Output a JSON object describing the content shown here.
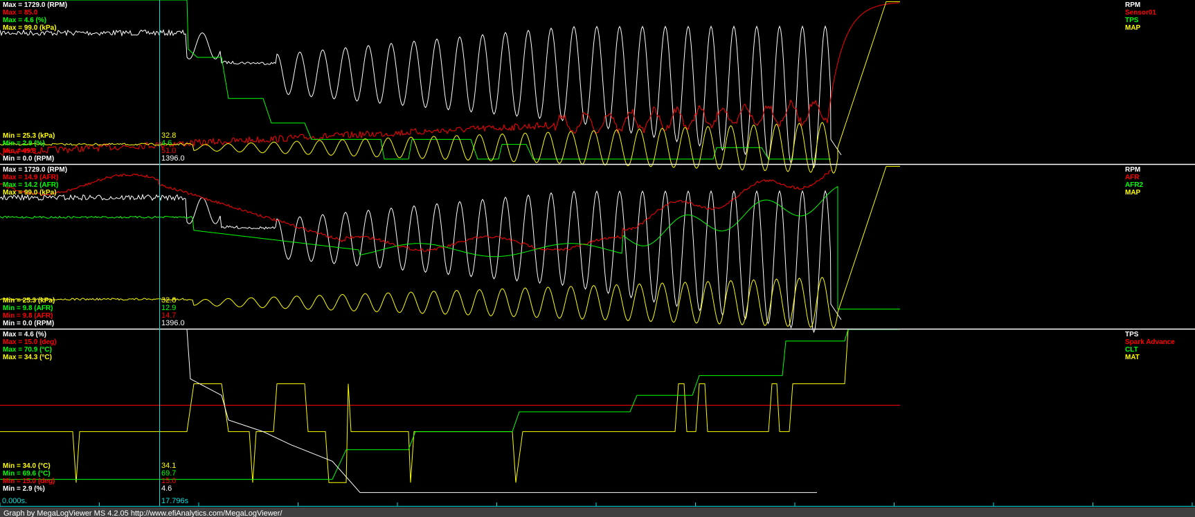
{
  "colors": {
    "background": "#000000",
    "white": "#ffffff",
    "red": "#ff0000",
    "green": "#00ff00",
    "yellow": "#ffff00",
    "cursor": "#00e0e0",
    "divider": "#ffffff",
    "footer_bg": "#404040"
  },
  "footer": {
    "credit": "Graph by MegaLogViewer MS 4.2.05 http://www.efiAnalytics.com/MegaLogViewer/"
  },
  "time_axis": {
    "start_label": "0.000s.",
    "cursor_label": "17.796s",
    "cursor_time": 17.796,
    "x_range": [
      0,
      100
    ]
  },
  "chart_data": [
    {
      "type": "line",
      "panel": 1,
      "series": [
        {
          "name": "RPM",
          "color": "#ffffff"
        },
        {
          "name": "Sensor01",
          "color": "#ff0000"
        },
        {
          "name": "TPS",
          "color": "#00ff00"
        },
        {
          "name": "MAP",
          "color": "#ffff00"
        }
      ],
      "max_labels": [
        {
          "text": "Max = 1729.0 (RPM)",
          "color": "#ffffff"
        },
        {
          "text": "Max = 85.0",
          "color": "#ff0000"
        },
        {
          "text": "Max = 4.6 (%)",
          "color": "#00ff00"
        },
        {
          "text": "Max = 99.0 (kPa)",
          "color": "#ffff00"
        }
      ],
      "min_labels": [
        {
          "text": "Min = 25.3 (kPa)",
          "color": "#ffff00"
        },
        {
          "text": "Min = 2.9 (%)",
          "color": "#00ff00"
        },
        {
          "text": "Min = 49.8",
          "color": "#ff0000"
        },
        {
          "text": "Min = 0.0 (RPM)",
          "color": "#ffffff"
        }
      ],
      "cursor_values": [
        {
          "text": "32.8",
          "color": "#ffff00"
        },
        {
          "text": "4.6",
          "color": "#00ff00"
        },
        {
          "text": "51.0",
          "color": "#ff0000"
        },
        {
          "text": "1396.0",
          "color": "#ffffff"
        }
      ]
    },
    {
      "type": "line",
      "panel": 2,
      "series": [
        {
          "name": "RPM",
          "color": "#ffffff"
        },
        {
          "name": "AFR",
          "color": "#ff0000"
        },
        {
          "name": "AFR2",
          "color": "#00ff00"
        },
        {
          "name": "MAP",
          "color": "#ffff00"
        }
      ],
      "max_labels": [
        {
          "text": "Max = 1729.0 (RPM)",
          "color": "#ffffff"
        },
        {
          "text": "Max = 14.9 (AFR)",
          "color": "#ff0000"
        },
        {
          "text": "Max = 14.2 (AFR)",
          "color": "#00ff00"
        },
        {
          "text": "Max = 99.0 (kPa)",
          "color": "#ffff00"
        }
      ],
      "min_labels": [
        {
          "text": "Min = 25.3 (kPa)",
          "color": "#ffff00"
        },
        {
          "text": "Min = 9.8 (AFR)",
          "color": "#00ff00"
        },
        {
          "text": "Min = 9.8 (AFR)",
          "color": "#ff0000"
        },
        {
          "text": "Min = 0.0 (RPM)",
          "color": "#ffffff"
        }
      ],
      "cursor_values": [
        {
          "text": "32.8",
          "color": "#ffff00"
        },
        {
          "text": "12.9",
          "color": "#00ff00"
        },
        {
          "text": "14.7",
          "color": "#ff0000"
        },
        {
          "text": "1396.0",
          "color": "#ffffff"
        }
      ]
    },
    {
      "type": "line",
      "panel": 3,
      "series": [
        {
          "name": "TPS",
          "color": "#ffffff"
        },
        {
          "name": "Spark Advance",
          "color": "#ff0000"
        },
        {
          "name": "CLT",
          "color": "#00ff00"
        },
        {
          "name": "MAT",
          "color": "#ffff00"
        }
      ],
      "max_labels": [
        {
          "text": "Max = 4.6 (%)",
          "color": "#ffffff"
        },
        {
          "text": "Max = 15.0 (deg)",
          "color": "#ff0000"
        },
        {
          "text": "Max = 70.9 (°C)",
          "color": "#00ff00"
        },
        {
          "text": "Max = 34.3 (°C)",
          "color": "#ffff00"
        }
      ],
      "min_labels": [
        {
          "text": "Min = 34.0 (°C)",
          "color": "#ffff00"
        },
        {
          "text": "Min = 69.6 (°C)",
          "color": "#00ff00"
        },
        {
          "text": "Min = 15.0 (deg)",
          "color": "#ff0000"
        },
        {
          "text": "Min = 2.9 (%)",
          "color": "#ffffff"
        }
      ],
      "cursor_values": [
        {
          "text": "34.1",
          "color": "#ffff00"
        },
        {
          "text": "69.7",
          "color": "#00ff00"
        },
        {
          "text": "15.0",
          "color": "#ff0000"
        },
        {
          "text": "4.6",
          "color": "#ffffff"
        }
      ]
    }
  ]
}
